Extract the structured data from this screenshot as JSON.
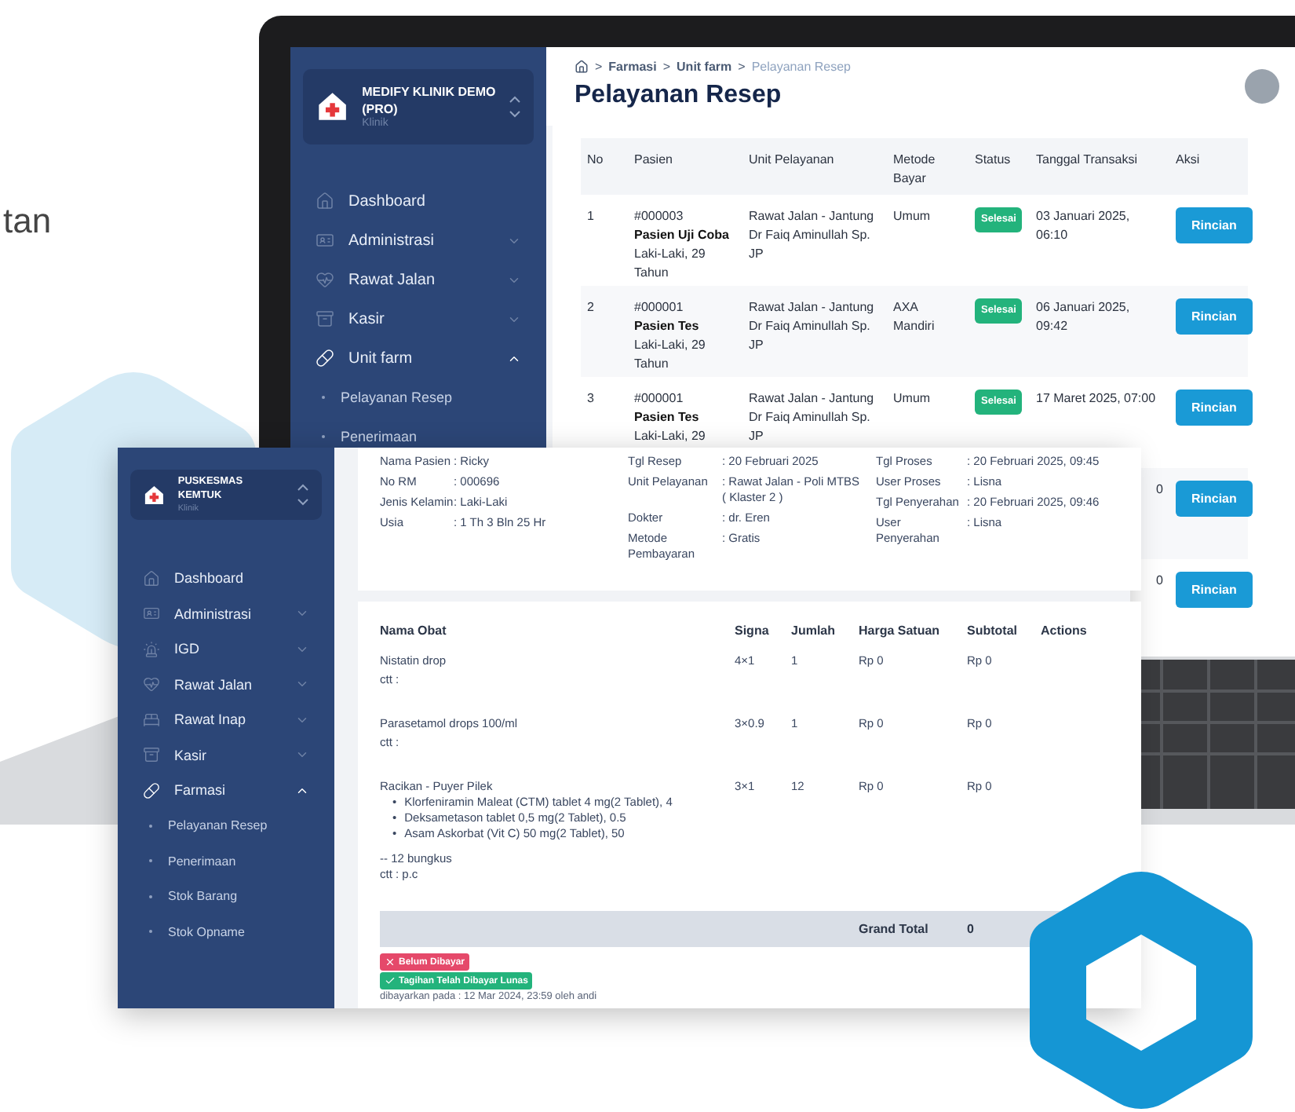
{
  "intro_text": "tan",
  "back_app": {
    "brand": {
      "name": "MEDIFY KLINIK DEMO (PRO)",
      "subtitle": "Klinik"
    },
    "nav": [
      {
        "label": "Dashboard",
        "kind": "link"
      },
      {
        "label": "Administrasi",
        "kind": "group",
        "expanded": false
      },
      {
        "label": "Rawat Jalan",
        "kind": "group",
        "expanded": false
      },
      {
        "label": "Kasir",
        "kind": "group",
        "expanded": false
      },
      {
        "label": "Unit farm",
        "kind": "group",
        "expanded": true,
        "children": [
          "Pelayanan Resep",
          "Penerimaan"
        ]
      }
    ],
    "breadcrumb": {
      "separator": ">",
      "items": [
        {
          "label": "Farmasi",
          "current": false
        },
        {
          "label": "Unit farm",
          "current": false
        },
        {
          "label": "Pelayanan Resep",
          "current": true
        }
      ]
    },
    "title": "Pelayanan Resep",
    "table": {
      "columns": [
        "No",
        "Pasien",
        "Unit Pelayanan",
        "Metode Bayar",
        "Status",
        "Tanggal Transaksi",
        "Aksi"
      ],
      "rows": [
        {
          "no": "1",
          "patient_id": "#000003",
          "patient_name": "Pasien Uji Coba",
          "patient_info": "Laki-Laki, 29 Tahun",
          "unit": "Rawat Jalan - Jantung Dr Faiq Aminullah Sp. JP",
          "payment": "Umum",
          "status": "Selesai",
          "date": "03 Januari 2025, 06:10",
          "action": "Rincian"
        },
        {
          "no": "2",
          "patient_id": "#000001",
          "patient_name": "Pasien Tes",
          "patient_info": "Laki-Laki, 29 Tahun",
          "unit": "Rawat Jalan - Jantung Dr Faiq Aminullah Sp. JP",
          "payment": "AXA Mandiri",
          "status": "Selesai",
          "date": "06 Januari 2025, 09:42",
          "action": "Rincian"
        },
        {
          "no": "3",
          "patient_id": "#000001",
          "patient_name": "Pasien Tes",
          "patient_info": "Laki-Laki, 29",
          "unit": "Rawat Jalan - Jantung Dr Faiq Aminullah Sp. JP",
          "payment": "Umum",
          "status": "Selesai",
          "date": "17 Maret 2025, 07:00",
          "action": "Rincian"
        },
        {
          "date": "0",
          "action": "Rincian"
        },
        {
          "date": "0",
          "action": "Rincian"
        }
      ]
    }
  },
  "front_app": {
    "brand": {
      "name": "PUSKESMAS KEMTUK",
      "subtitle": "Klinik"
    },
    "nav": [
      {
        "label": "Dashboard",
        "kind": "link"
      },
      {
        "label": "Administrasi",
        "kind": "group",
        "expanded": false
      },
      {
        "label": "IGD",
        "kind": "group",
        "expanded": false
      },
      {
        "label": "Rawat Jalan",
        "kind": "group",
        "expanded": false
      },
      {
        "label": "Rawat Inap",
        "kind": "group",
        "expanded": false
      },
      {
        "label": "Kasir",
        "kind": "group",
        "expanded": false
      },
      {
        "label": "Farmasi",
        "kind": "group",
        "expanded": true,
        "children": [
          "Pelayanan Resep",
          "Penerimaan",
          "Stok Barang",
          "Stok Opname"
        ]
      }
    ],
    "patient": [
      {
        "label": "Nama Pasien",
        "value": ": Ricky"
      },
      {
        "label": "No RM",
        "value": ": 000696"
      },
      {
        "label": "Jenis Kelamin",
        "value": ": Laki-Laki"
      },
      {
        "label": "Usia",
        "value": ": 1 Th 3 Bln 25 Hr"
      }
    ],
    "prescription": [
      {
        "label": "Tgl Resep",
        "value": ": 20 Februari 2025"
      },
      {
        "label": "Unit Pelayanan",
        "value": ": Rawat Jalan - Poli MTBS ( Klaster 2 )"
      },
      {
        "label": "Dokter",
        "value": ": dr. Eren"
      },
      {
        "label": "Metode Pembayaran",
        "value": ": Gratis"
      }
    ],
    "process": [
      {
        "label": "Tgl Proses",
        "value": ": 20 Februari 2025, 09:45"
      },
      {
        "label": "User Proses",
        "value": ": Lisna"
      },
      {
        "label": "Tgl Penyerahan",
        "value": ": 20 Februari 2025, 09:46"
      },
      {
        "label": "User Penyerahan",
        "value": ": Lisna"
      }
    ],
    "medicines": {
      "columns": [
        "Nama Obat",
        "Signa",
        "Jumlah",
        "Harga Satuan",
        "Subtotal",
        "Actions"
      ],
      "rows": [
        {
          "name": "Nistatin drop",
          "note": "ctt :",
          "signa": "4×1",
          "qty": "1",
          "price": "Rp 0",
          "subtotal": "Rp 0"
        },
        {
          "name": "Parasetamol drops 100/ml",
          "note": "ctt :",
          "signa": "3×0.9",
          "qty": "1",
          "price": "Rp 0",
          "subtotal": "Rp 0"
        },
        {
          "name": "Racikan - Puyer Pilek",
          "ingredients": [
            "Klorfeniramin Maleat (CTM) tablet 4 mg(2 Tablet), 4",
            "Deksametason tablet 0,5 mg(2 Tablet), 0.5",
            "Asam Askorbat (Vit C) 50 mg(2 Tablet), 50"
          ],
          "packs": "-- 12 bungkus",
          "note": "ctt : p.c",
          "signa": "3×1",
          "qty": "12",
          "price": "Rp 0",
          "subtotal": "Rp 0"
        }
      ],
      "bullet": "•",
      "total_label": "Grand Total",
      "total_value": "0"
    },
    "badges": [
      {
        "kind": "unpaid",
        "label": "Belum Dibayar"
      },
      {
        "kind": "paid",
        "label": "Tagihan Telah Dibayar Lunas"
      }
    ],
    "paid_note": "dibayarkan pada : 12 Mar 2024, 23:59 oleh andi"
  }
}
